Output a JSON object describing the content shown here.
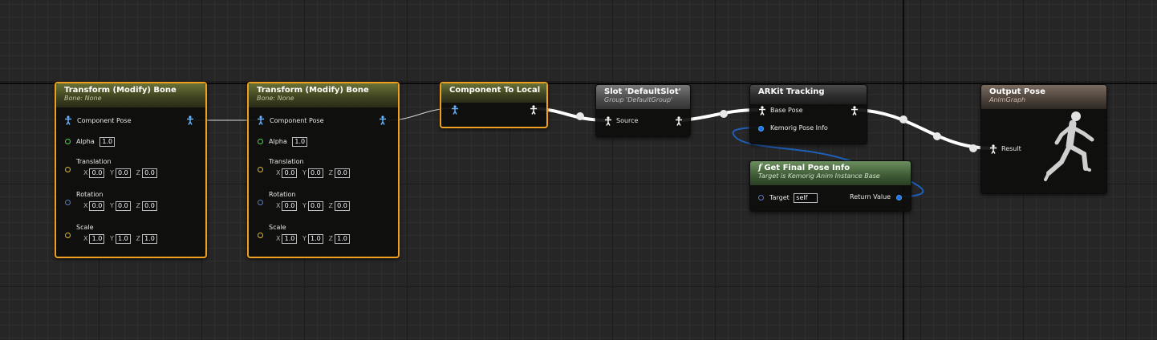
{
  "graph": {
    "name": "AnimGraph"
  },
  "nodes": {
    "transform1": {
      "title": "Transform (Modify) Bone",
      "subtitle": "Bone: None",
      "component_pose": "Component Pose",
      "alpha_label": "Alpha",
      "alpha": "1.0",
      "translation_label": "Translation",
      "translation": [
        "0.0",
        "0.0",
        "0.0"
      ],
      "rotation_label": "Rotation",
      "rotation": [
        "0.0",
        "0.0",
        "0.0"
      ],
      "scale_label": "Scale",
      "scale": [
        "1.0",
        "1.0",
        "1.0"
      ]
    },
    "transform2": {
      "title": "Transform (Modify) Bone",
      "subtitle": "Bone: None",
      "component_pose": "Component Pose",
      "alpha_label": "Alpha",
      "alpha": "1.0",
      "translation_label": "Translation",
      "translation": [
        "0.0",
        "0.0",
        "0.0"
      ],
      "rotation_label": "Rotation",
      "rotation": [
        "0.0",
        "0.0",
        "0.0"
      ],
      "scale_label": "Scale",
      "scale": [
        "1.0",
        "1.0",
        "1.0"
      ]
    },
    "component_to_local": {
      "title": "Component To Local"
    },
    "slot": {
      "title": "Slot 'DefaultSlot'",
      "subtitle": "Group 'DefaultGroup'",
      "source": "Source"
    },
    "arkit": {
      "title": "ARKit Tracking",
      "base_pose": "Base Pose",
      "pose_info": "Kemorig Pose Info"
    },
    "get_final": {
      "icon": "f",
      "title": "Get Final Pose Info",
      "subtitle": "Target is Kemorig Anim Instance Base",
      "target_label": "Target",
      "target_value": "self",
      "return_value": "Return Value"
    },
    "output": {
      "title": "Output Pose",
      "subtitle": "AnimGraph",
      "result": "Result"
    }
  },
  "axis_labels": {
    "x": "X",
    "y": "Y",
    "z": "Z"
  },
  "icons": {
    "pose": "pose-pin-icon",
    "exec_pin_color": "#ffffff",
    "float_pin_color": "#55d04b",
    "vector_pin_color": "#d9b630",
    "rotator_pin_color": "#5a78c8",
    "struct_pin_color": "#1d74e0",
    "selected_color": "#f0a020"
  }
}
